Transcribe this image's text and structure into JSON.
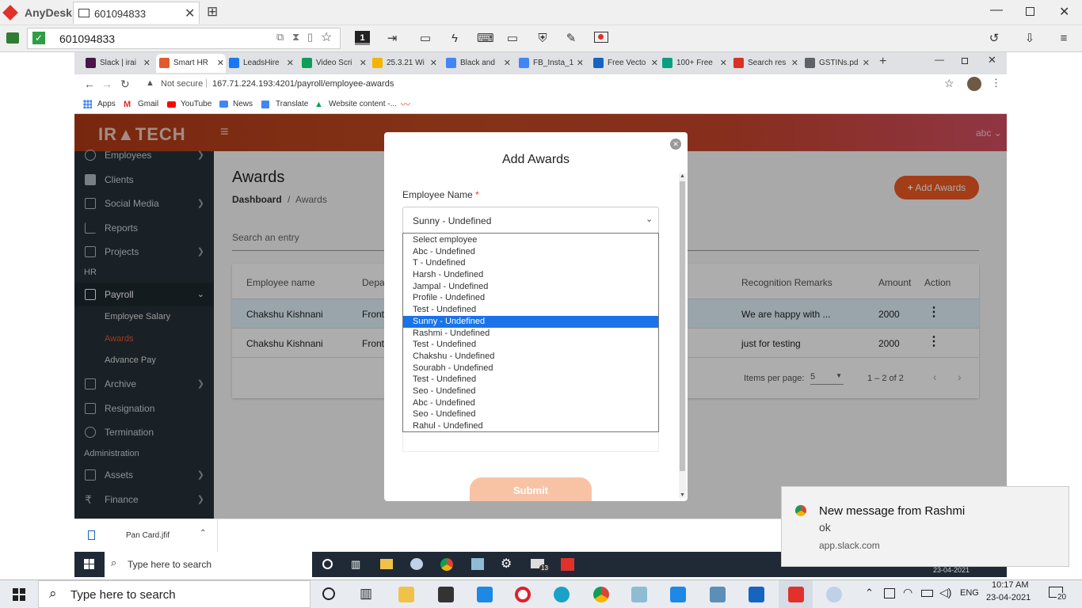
{
  "anydesk": {
    "app_name": "AnyDesk",
    "session_tab": "601094833",
    "address_value": "601094833",
    "monitor_number": "1"
  },
  "browser": {
    "tabs": [
      {
        "label": "Slack | irai",
        "color": "#4a154b"
      },
      {
        "label": "Smart HR",
        "color": "#e25a2c"
      },
      {
        "label": "LeadsHire",
        "color": "#1877f2"
      },
      {
        "label": "Video Scri",
        "color": "#0f9d58"
      },
      {
        "label": "25.3.21 Wi",
        "color": "#f4b400"
      },
      {
        "label": "Black and",
        "color": "#4285f4"
      },
      {
        "label": "FB_Insta_1",
        "color": "#4285f4"
      },
      {
        "label": "Free Vecto",
        "color": "#1565c0"
      },
      {
        "label": "100+ Free",
        "color": "#05a081"
      },
      {
        "label": "Search res",
        "color": "#d93025"
      },
      {
        "label": "GSTINs.pd",
        "color": "#5f6368"
      }
    ],
    "not_secure": "Not secure",
    "url": "167.71.224.193:4201/payroll/employee-awards",
    "bookmarks": [
      "Apps",
      "Gmail",
      "YouTube",
      "News",
      "Translate",
      "Website content -..."
    ]
  },
  "app": {
    "brand": "IR▲TECH",
    "user": "abc",
    "sidebar": {
      "items_top": [
        {
          "label": "Employees",
          "chevron": true
        },
        {
          "label": "Clients",
          "chevron": false
        },
        {
          "label": "Social Media",
          "chevron": true
        },
        {
          "label": "Reports",
          "chevron": false
        },
        {
          "label": "Projects",
          "chevron": true
        }
      ],
      "section_hr": "HR",
      "payroll": "Payroll",
      "payroll_sub": [
        "Employee Salary",
        "Awards",
        "Advance Pay"
      ],
      "items_mid": [
        {
          "label": "Archive",
          "chevron": true
        },
        {
          "label": "Resignation",
          "chevron": false
        },
        {
          "label": "Termination",
          "chevron": false
        }
      ],
      "section_admin": "Administration",
      "items_bottom": [
        {
          "label": "Assets",
          "chevron": true
        },
        {
          "label": "Finance",
          "chevron": true
        }
      ]
    },
    "page_title": "Awards",
    "breadcrumb_home": "Dashboard",
    "breadcrumb_sep": "/",
    "breadcrumb_current": "Awards",
    "add_button": "Add Awards",
    "search_placeholder": "Search an entry",
    "table": {
      "headers": [
        "Employee name",
        "Depa",
        "Recognition Remarks",
        "Amount",
        "Action"
      ],
      "rows": [
        {
          "name": "Chakshu Kishnani",
          "dept": "Front",
          "remarks": "We are happy with ...",
          "amount": "2000"
        },
        {
          "name": "Chakshu Kishnani",
          "dept": "Front",
          "remarks": "just for testing",
          "amount": "2000"
        }
      ],
      "items_per_page_label": "Items per page:",
      "items_per_page": "5",
      "range": "1 – 2 of 2"
    }
  },
  "modal": {
    "title": "Add Awards",
    "field_label": "Employee Name",
    "required_mark": "*",
    "selected_value": "Sunny - Undefined",
    "options": [
      "Select employee",
      "Abc - Undefined",
      "T - Undefined",
      "Harsh - Undefined",
      "Jampal - Undefined",
      "Profile - Undefined",
      "Test - Undefined",
      "Sunny - Undefined",
      "Rashmi - Undefined",
      "Test - Undefined",
      "Chakshu - Undefined",
      "Sourabh - Undefined",
      "Test - Undefined",
      "Seo - Undefined",
      "Abc - Undefined",
      "Seo - Undefined",
      "Rahul - Undefined"
    ],
    "highlighted_index": 7,
    "submit": "Submit"
  },
  "downloads": {
    "file": "Pan Card.jfif"
  },
  "remote_taskbar": {
    "search_placeholder": "Type here to search",
    "date": "23-04-2021",
    "badge": "13"
  },
  "taskbar": {
    "search_placeholder": "Type here to search",
    "lang": "ENG",
    "time": "10:17 AM",
    "date": "23-04-2021",
    "notif_count": "20"
  },
  "toast": {
    "title": "New message from Rashmi",
    "body": "ok",
    "source": "app.slack.com"
  }
}
